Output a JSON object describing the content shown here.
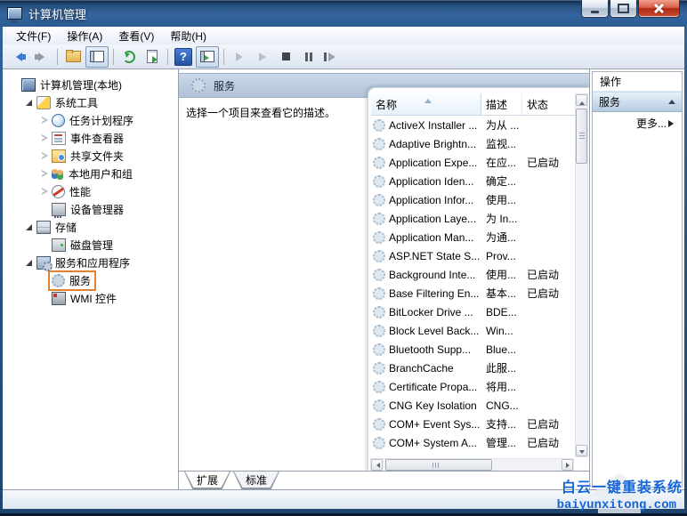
{
  "window": {
    "title": "计算机管理",
    "controls": [
      "minimize-icon",
      "maximize-icon",
      "close-icon"
    ]
  },
  "menu": {
    "items": [
      "文件(F)",
      "操作(A)",
      "查看(V)",
      "帮助(H)"
    ]
  },
  "toolbar": {
    "icons": [
      "back-icon",
      "forward-icon",
      "separator",
      "folder-icon",
      "console-tree-icon",
      "separator",
      "refresh-icon",
      "export-list-icon",
      "separator",
      "help-icon",
      "action-pane-icon",
      "separator",
      "start-service-icon",
      "resume-service-icon",
      "stop-service-icon",
      "pause-service-icon",
      "restart-service-icon"
    ]
  },
  "tree": {
    "items": [
      {
        "label": "计算机管理(本地)",
        "level": 0,
        "expander": "none",
        "icon": "computer",
        "highlighted": false
      },
      {
        "label": "系统工具",
        "level": 1,
        "expander": "expanded",
        "icon": "systools",
        "highlighted": false
      },
      {
        "label": "任务计划程序",
        "level": 2,
        "expander": "collapsed",
        "icon": "scheduler",
        "highlighted": false
      },
      {
        "label": "事件查看器",
        "level": 2,
        "expander": "collapsed",
        "icon": "eventviewer",
        "highlighted": false
      },
      {
        "label": "共享文件夹",
        "level": 2,
        "expander": "collapsed",
        "icon": "sharedfolders",
        "highlighted": false
      },
      {
        "label": "本地用户和组",
        "level": 2,
        "expander": "collapsed",
        "icon": "users",
        "highlighted": false
      },
      {
        "label": "性能",
        "level": 2,
        "expander": "collapsed",
        "icon": "performance",
        "highlighted": false
      },
      {
        "label": "设备管理器",
        "level": 2,
        "expander": "none",
        "icon": "devicemgr",
        "highlighted": false
      },
      {
        "label": "存储",
        "level": 1,
        "expander": "expanded",
        "icon": "storage",
        "highlighted": false
      },
      {
        "label": "磁盘管理",
        "level": 2,
        "expander": "none",
        "icon": "diskmgmt",
        "highlighted": false
      },
      {
        "label": "服务和应用程序",
        "level": 1,
        "expander": "expanded",
        "icon": "svcapps",
        "highlighted": false
      },
      {
        "label": "服务",
        "level": 2,
        "expander": "none",
        "icon": "services",
        "highlighted": true
      },
      {
        "label": "WMI 控件",
        "level": 2,
        "expander": "none",
        "icon": "wmi",
        "highlighted": false
      }
    ]
  },
  "main": {
    "header_title": "服务",
    "description": "选择一个项目来查看它的描述。",
    "table": {
      "columns": [
        {
          "label": "名称",
          "sorted": "ascending"
        },
        {
          "label": "描述",
          "sorted": ""
        },
        {
          "label": "状态",
          "sorted": ""
        }
      ],
      "rows": [
        {
          "name": "ActiveX Installer ...",
          "desc": "为从 ...",
          "status": ""
        },
        {
          "name": "Adaptive Brightn...",
          "desc": "监视...",
          "status": ""
        },
        {
          "name": "Application Expe...",
          "desc": "在应...",
          "status": "已启动"
        },
        {
          "name": "Application Iden...",
          "desc": "确定...",
          "status": ""
        },
        {
          "name": "Application Infor...",
          "desc": "使用...",
          "status": ""
        },
        {
          "name": "Application Laye...",
          "desc": "为 In...",
          "status": ""
        },
        {
          "name": "Application Man...",
          "desc": "为通...",
          "status": ""
        },
        {
          "name": "ASP.NET State S...",
          "desc": "Prov...",
          "status": ""
        },
        {
          "name": "Background Inte...",
          "desc": "使用...",
          "status": "已启动"
        },
        {
          "name": "Base Filtering En...",
          "desc": "基本...",
          "status": "已启动"
        },
        {
          "name": "BitLocker Drive ...",
          "desc": "BDE...",
          "status": ""
        },
        {
          "name": "Block Level Back...",
          "desc": "Win...",
          "status": ""
        },
        {
          "name": "Bluetooth Supp...",
          "desc": "Blue...",
          "status": ""
        },
        {
          "name": "BranchCache",
          "desc": "此服...",
          "status": ""
        },
        {
          "name": "Certificate Propa...",
          "desc": "将用...",
          "status": ""
        },
        {
          "name": "CNG Key Isolation",
          "desc": "CNG...",
          "status": ""
        },
        {
          "name": "COM+ Event Sys...",
          "desc": "支持...",
          "status": "已启动"
        },
        {
          "name": "COM+ System A...",
          "desc": "管理...",
          "status": "已启动"
        }
      ]
    },
    "tabs": [
      {
        "label": "扩展",
        "active": true
      },
      {
        "label": "标准",
        "active": false
      }
    ]
  },
  "actions": {
    "title": "操作",
    "section_title": "服务",
    "more_label": "更多..."
  },
  "watermark": {
    "line1": "白云一键重装系统",
    "line2": "baiyunxitong.com"
  },
  "colors": {
    "highlight_orange": "#e2812f",
    "titlebar_blue": "#2c5b92",
    "watermark_blue": "#1565d8"
  }
}
